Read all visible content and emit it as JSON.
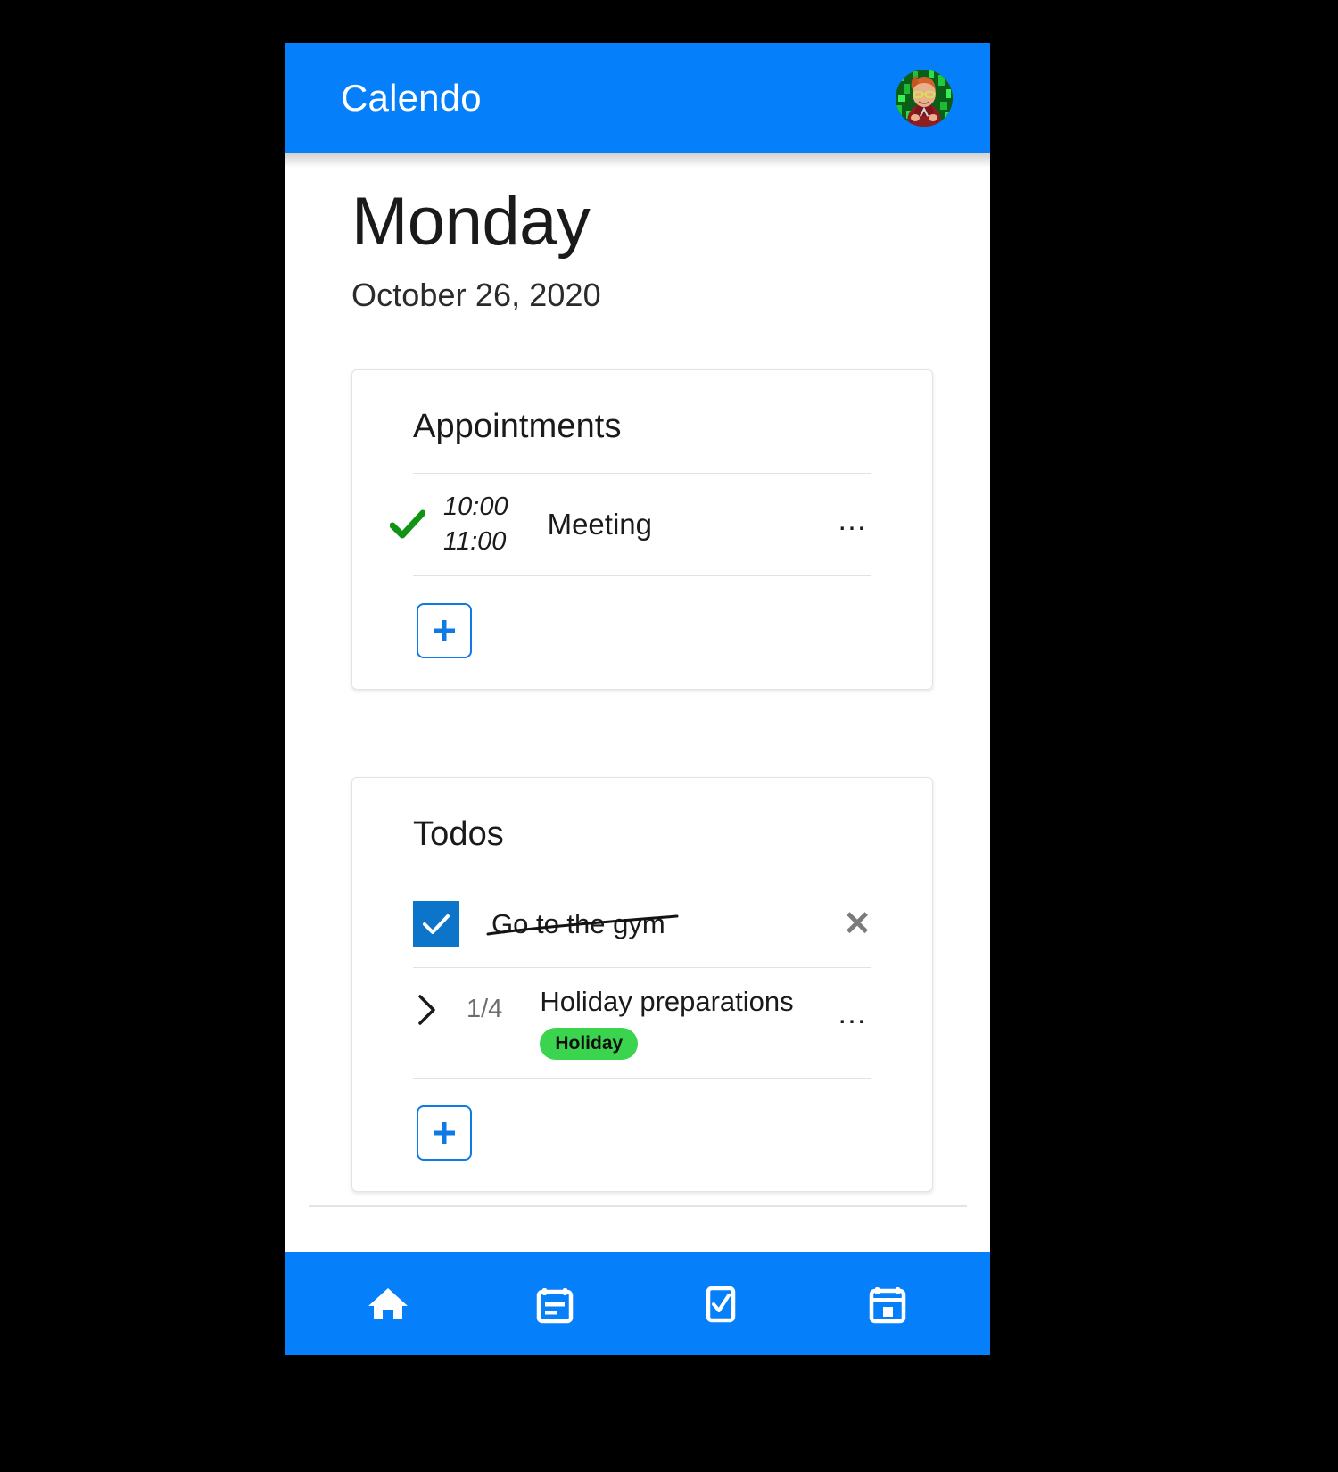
{
  "app": {
    "title": "Calendo",
    "accent_blue": "#0580fa",
    "avatar_alt": "user-avatar"
  },
  "header": {
    "day": "Monday",
    "date": "October 26, 2020"
  },
  "appointments_card": {
    "title": "Appointments",
    "items": [
      {
        "status_icon": "green-check-icon",
        "start_time": "10:00",
        "end_time": "11:00",
        "label": "Meeting",
        "menu": "…"
      }
    ],
    "add_label": "+"
  },
  "todos_card": {
    "title": "Todos",
    "items": [
      {
        "kind": "checkbox",
        "checked": true,
        "label": "Go to the gym",
        "remove": "✕"
      },
      {
        "kind": "group",
        "expander_icon": "chevron-right-icon",
        "count": "1/4",
        "label": "Holiday preparations",
        "badge": "Holiday",
        "badge_color": "#3bd44f",
        "menu": "…"
      }
    ],
    "add_label": "+"
  },
  "bottom_nav": {
    "items": [
      {
        "icon": "home-icon",
        "name": "home"
      },
      {
        "icon": "agenda-icon",
        "name": "appointments"
      },
      {
        "icon": "checkbox-icon",
        "name": "todos"
      },
      {
        "icon": "calendar-day-icon",
        "name": "calendar"
      }
    ]
  }
}
